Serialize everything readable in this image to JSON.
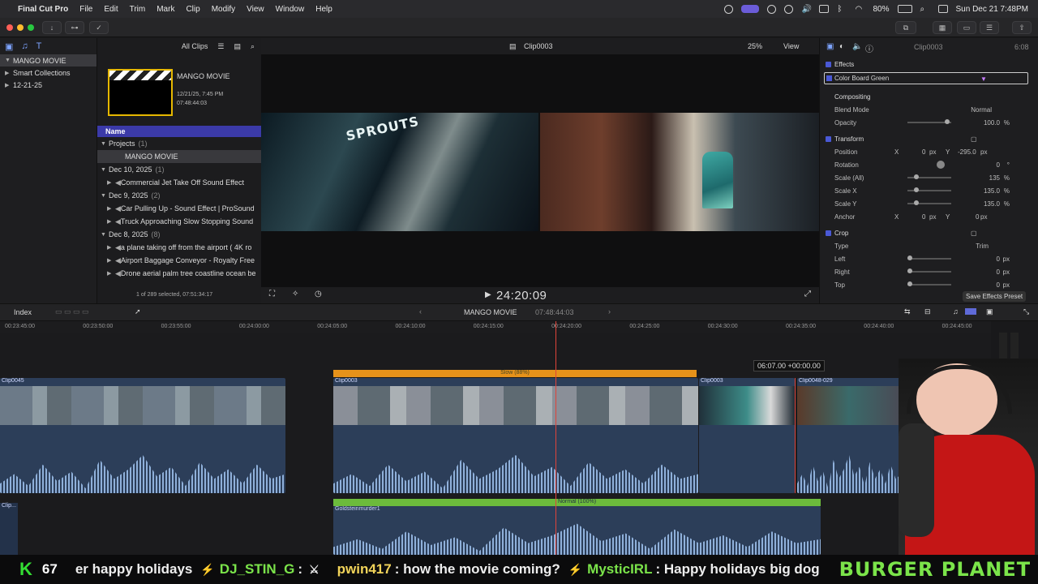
{
  "menubar": {
    "app": "Final Cut Pro",
    "menus": [
      "File",
      "Edit",
      "Trim",
      "Mark",
      "Clip",
      "Modify",
      "View",
      "Window",
      "Help"
    ],
    "battery": "80%",
    "datetime": "Sun Dec 21  7:48PM"
  },
  "browser": {
    "filter": "All Clips",
    "library": "MANGO MOVIE",
    "smart": "Smart Collections",
    "event": "12-21-25",
    "thumb_title": "MANGO MOVIE",
    "thumb_date": "12/21/25, 7:45 PM",
    "thumb_tc": "07:48:44:03",
    "col_name": "Name",
    "rows": [
      {
        "type": "grp",
        "label": "Projects",
        "count": "(1)"
      },
      {
        "type": "sel",
        "label": "MANGO MOVIE"
      },
      {
        "type": "grp",
        "label": "Dec 10, 2025",
        "count": "(1)"
      },
      {
        "type": "item",
        "label": "Commercial Jet Take Off Sound Effect"
      },
      {
        "type": "grp",
        "label": "Dec 9, 2025",
        "count": "(2)"
      },
      {
        "type": "item",
        "label": "Car Pulling Up - Sound Effect  |  ProSound"
      },
      {
        "type": "item",
        "label": "Truck Approaching Slow Stopping Sound"
      },
      {
        "type": "grp",
        "label": "Dec 8, 2025",
        "count": "(8)"
      },
      {
        "type": "item",
        "label": "a plane taking off from the airport ( 4K ro"
      },
      {
        "type": "item",
        "label": "Airport Baggage Conveyor - Royalty Free"
      },
      {
        "type": "item",
        "label": "Drone aerial palm tree coastline ocean be"
      }
    ],
    "status": "1 of 289 selected, 07:51:34:17"
  },
  "viewer": {
    "clip": "Clip0003",
    "zoom": "25%",
    "view": "View",
    "timecode": "24:20:09",
    "frame_sign": "SPROUTS"
  },
  "inspector": {
    "clip": "Clip0003",
    "duration": "6:08",
    "effects": "Effects",
    "effect_name": "Color Board Green",
    "compositing": "Compositing",
    "blend_label": "Blend Mode",
    "blend_val": "Normal",
    "opacity_label": "Opacity",
    "opacity_val": "100.0",
    "transform": "Transform",
    "position": "Position",
    "pos_x": "0",
    "pos_y": "-295.0",
    "rotation": "Rotation",
    "rot_val": "0",
    "scale_all": "Scale (All)",
    "scale_all_val": "135",
    "scale_x": "Scale X",
    "scale_x_val": "135.0",
    "scale_y": "Scale Y",
    "scale_y_val": "135.0",
    "anchor": "Anchor",
    "anc_x": "0",
    "anc_y": "0",
    "crop": "Crop",
    "type": "Type",
    "type_val": "Trim",
    "left": "Left",
    "left_val": "0",
    "right": "Right",
    "right_val": "0",
    "top": "Top",
    "top_val": "0",
    "save_preset": "Save Effects Preset",
    "px": "px",
    "pct": "%",
    "deg": "°"
  },
  "timeline": {
    "index": "Index",
    "project": "MANGO MOVIE",
    "project_tc": "07:48:44:03",
    "ticks": [
      "00:23:45:00",
      "00:23:50:00",
      "00:23:55:00",
      "00:24:00:00",
      "00:24:05:00",
      "00:24:10:00",
      "00:24:15:00",
      "00:24:20:00",
      "00:24:25:00",
      "00:24:30:00",
      "00:24:35:00",
      "00:24:40:00",
      "00:24:45:00"
    ],
    "retime": "Slow (88%)",
    "trim_readout": "06:07.00  +00:00.00",
    "clips": [
      "Clip0045",
      "Clip0003",
      "Clip0003",
      "Clip0048-029"
    ],
    "audio_retime": "Normal (100%)",
    "audio_clip": "Goldsteinmurder1",
    "small_clip": "Clip..."
  },
  "ticker": {
    "count": "67",
    "messages": [
      {
        "user": "",
        "text": "er happy holidays"
      },
      {
        "user": "DJ_STIN_G",
        "text": ":"
      },
      {
        "user": "pwin417",
        "text": ": how the movie coming?"
      },
      {
        "user": "MysticIRL",
        "text": ": Happy holidays big dog"
      }
    ],
    "brand": "BURGER PLANET"
  }
}
